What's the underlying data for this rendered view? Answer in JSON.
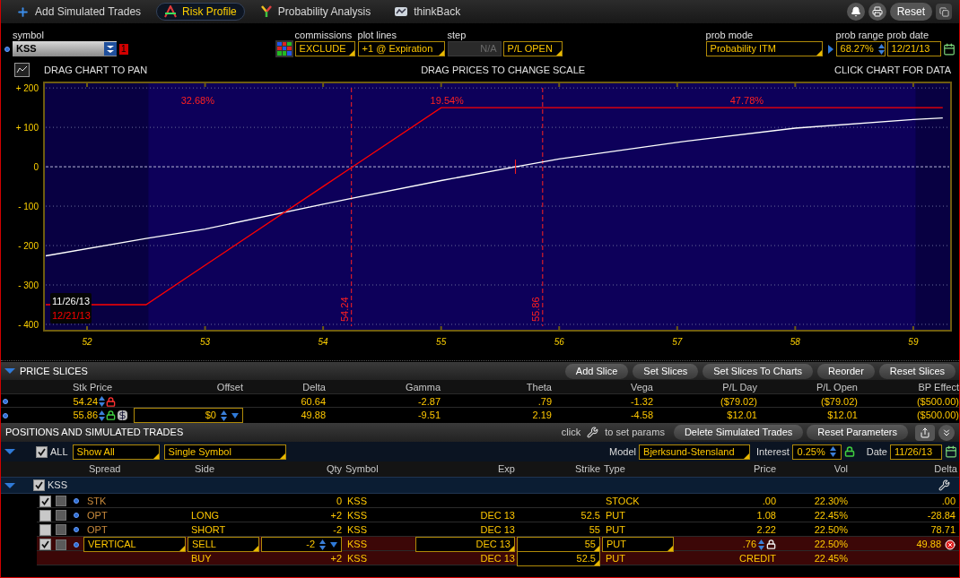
{
  "toolbar": {
    "tabs": [
      {
        "label": "Add Simulated Trades",
        "selected": false
      },
      {
        "label": "Risk Profile",
        "selected": true
      },
      {
        "label": "Probability Analysis",
        "selected": false
      },
      {
        "label": "thinkBack",
        "selected": false
      }
    ],
    "reset": "Reset"
  },
  "controls": {
    "symbol": {
      "label": "symbol",
      "value": "KSS",
      "badge": "1"
    },
    "commissions": {
      "label": "commissions",
      "value": "EXCLUDE"
    },
    "plot_lines": {
      "label": "plot lines",
      "value": "+1 @ Expiration"
    },
    "step": {
      "label": "step",
      "value": "N/A",
      "disabled": true
    },
    "pl_mode": {
      "value": "P/L OPEN"
    },
    "prob_mode": {
      "label": "prob mode",
      "value": "Probability ITM"
    },
    "prob_range": {
      "label": "prob range",
      "value": "68.27%"
    },
    "prob_date": {
      "label": "prob date",
      "value": "12/21/13"
    }
  },
  "hints": [
    "DRAG CHART TO PAN",
    "DRAG PRICES TO CHANGE SCALE",
    "CLICK CHART FOR DATA"
  ],
  "chart": {
    "chart_data": {
      "type": "line",
      "grid": true,
      "x": [
        51.65,
        52.5,
        53,
        54,
        54.24,
        55,
        55.63,
        56,
        57,
        58,
        59,
        59.25
      ],
      "series": [
        {
          "name": "11/26/13",
          "color": "#ffffff",
          "values": [
            -226,
            -182,
            -158,
            -95,
            -80,
            -35,
            0,
            20,
            62,
            98,
            120,
            124
          ]
        },
        {
          "name": "12/21/13",
          "color": "#ff0000",
          "values": [
            -350,
            -350,
            -250,
            -50,
            -2,
            150,
            150,
            150,
            150,
            150,
            150,
            150
          ]
        }
      ],
      "xlim": [
        51.635,
        59.32
      ],
      "ylim": [
        -416,
        214
      ],
      "xticks": [
        52,
        53,
        54,
        55,
        56,
        57,
        58,
        59
      ],
      "yticks": [
        {
          "value": 200,
          "label": "+ 200"
        },
        {
          "value": 100,
          "label": "+ 100"
        },
        {
          "value": 0,
          "label": "0"
        },
        {
          "value": -100,
          "label": "- 100"
        },
        {
          "value": -200,
          "label": "- 200"
        },
        {
          "value": -300,
          "label": "- 300"
        },
        {
          "value": -400,
          "label": "- 400"
        }
      ],
      "ref_lines": [
        {
          "axis": "y",
          "value": 0
        },
        {
          "axis": "x",
          "value": 54.24,
          "label": "54.24"
        },
        {
          "axis": "x",
          "value": 55.86,
          "label": "55.86"
        }
      ],
      "bands": [
        {
          "axis": "x",
          "from": 51.635,
          "to": 52.52
        },
        {
          "axis": "x",
          "from": 59.02,
          "to": 59.32
        }
      ],
      "annotations": [
        "32.68%",
        "19.54%",
        "47.78%"
      ]
    }
  },
  "price_slices": {
    "title": "PRICE SLICES",
    "expanded": true,
    "buttons": [
      "Add Slice",
      "Set Slices",
      "Set Slices To Charts",
      "Reorder",
      "Reset Slices"
    ],
    "columns": [
      "Stk Price",
      "Offset",
      "Delta",
      "Gamma",
      "Theta",
      "Vega",
      "P/L Day",
      "P/L Open",
      "BP Effect"
    ],
    "rows": [
      {
        "locked": true,
        "cells": [
          "54.24",
          "",
          "60.64",
          "-2.87",
          ".79",
          "-1.32",
          "($79.02)",
          "($79.02)",
          "($500.00)"
        ]
      },
      {
        "locked": false,
        "cells": [
          "55.86",
          "$0",
          "49.88",
          "-9.51",
          "2.19",
          "-4.58",
          "$12.01",
          "$12.01",
          "($500.00)"
        ]
      }
    ]
  },
  "positions": {
    "title": "POSITIONS AND SIMULATED TRADES",
    "hint_before": "click",
    "hint_after": "to set params",
    "buttons": [
      "Delete Simulated Trades",
      "Reset Parameters"
    ],
    "filter": {
      "all": {
        "label": "ALL",
        "checked": true
      },
      "show": "Show All",
      "scope": "Single Symbol",
      "model_label": "Model",
      "model": "Bjerksund-Stensland",
      "interest_label": "Interest",
      "interest": "0.25%",
      "date_label": "Date",
      "date": "11/26/13"
    },
    "columns": [
      "Spread",
      "Side",
      "Qty",
      "Symbol",
      "Exp",
      "Strike",
      "Type",
      "Price",
      "Vol",
      "Delta"
    ],
    "group": {
      "symbol": "KSS",
      "checked": true,
      "expanded": true
    },
    "rows": [
      {
        "kind": "plain",
        "checked": true,
        "spread": "STK",
        "qty": "0",
        "symbol": "KSS",
        "type": "STOCK",
        "price": ".00",
        "vol": "22.30%",
        "delta": ".00"
      },
      {
        "kind": "plain",
        "checked": false,
        "spread": "OPT",
        "side": "LONG",
        "qty": "+2",
        "symbol": "KSS",
        "exp": "DEC 13",
        "strike": "52.5",
        "type": "PUT",
        "price": "1.08",
        "vol": "22.45%",
        "delta": "-28.84"
      },
      {
        "kind": "plain",
        "checked": false,
        "spread": "OPT",
        "side": "SHORT",
        "qty": "-2",
        "symbol": "KSS",
        "exp": "DEC 13",
        "strike": "55",
        "type": "PUT",
        "price": "2.22",
        "vol": "22.50%",
        "delta": "78.71"
      },
      {
        "kind": "editable",
        "checked": true,
        "locked": true,
        "removable": true,
        "spread": "VERTICAL",
        "side": "SELL",
        "qty": "-2",
        "symbol": "KSS",
        "exp": "DEC 13",
        "strike": "55",
        "type": "PUT",
        "price": ".76",
        "vol": "22.50%",
        "delta": "49.88"
      },
      {
        "kind": "leg",
        "side": "BUY",
        "qty": "+2",
        "symbol": "KSS",
        "exp": "DEC 13",
        "strike": "52.5",
        "type": "PUT",
        "price": "CREDIT",
        "vol": "22.45%"
      }
    ]
  }
}
